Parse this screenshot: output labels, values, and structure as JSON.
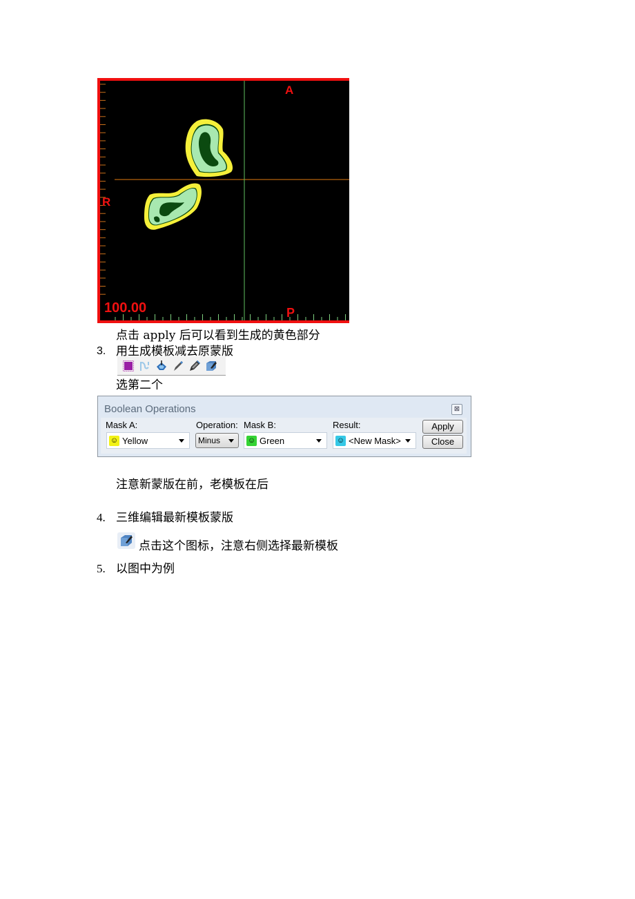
{
  "viewer": {
    "label_top": "A",
    "label_left": "R",
    "label_bottom": "P",
    "scale_readout": "100.00",
    "colors": {
      "frame": "#f01010",
      "mask_outer": "#f5f03a",
      "mask_fill": "#a8e8b0",
      "mask_core": "#0b4a10",
      "crosshair_h": "#e07a10",
      "crosshair_v": "#5fbf5f"
    }
  },
  "caption_after_apply": "点击 apply 后可以看到生成的黄色部分",
  "steps": [
    {
      "number": "3.",
      "title": "用生成模板减去原蒙版"
    },
    {
      "number": "4.",
      "title": "三维编辑最新模板蒙版"
    },
    {
      "number": "5.",
      "title": "以图中为例"
    }
  ],
  "toolbar": {
    "icons": [
      "mask-square-icon",
      "split-mask-icon",
      "fill-bucket-icon",
      "pencil-icon",
      "thick-pencil-icon",
      "3d-edit-icon"
    ]
  },
  "choose_second_text": "选第二个",
  "boolean_dialog": {
    "title": "Boolean Operations",
    "close_symbol": "⊠",
    "mask_a": {
      "label": "Mask A:",
      "value": "Yellow",
      "color": "#f2f216"
    },
    "operation": {
      "label": "Operation:",
      "value": "Minus"
    },
    "mask_b": {
      "label": "Mask B:",
      "value": "Green",
      "color": "#34d334"
    },
    "result": {
      "label": "Result:",
      "value": "<New Mask>",
      "color": "#35c8e6"
    },
    "apply_label": "Apply",
    "close_label": "Close"
  },
  "note_order": "注意新蒙版在前，老模板在后",
  "icon_instruction": "点击这个图标，注意右侧选择最新模板"
}
